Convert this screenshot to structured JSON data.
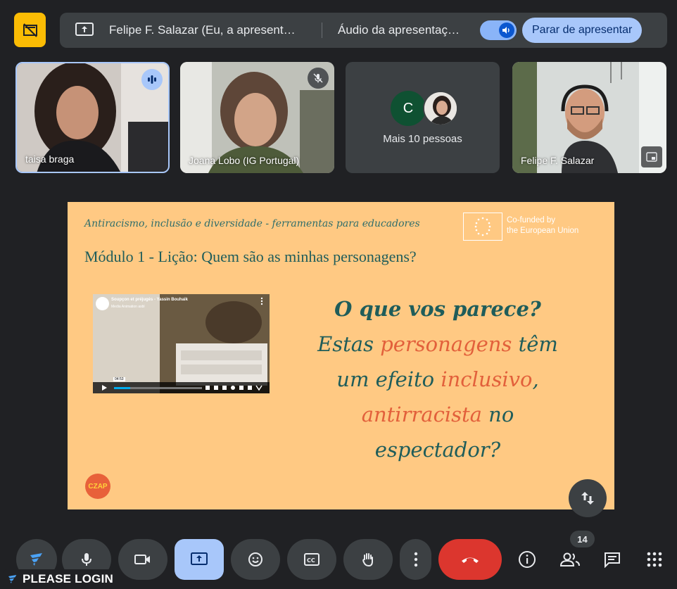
{
  "presenting": {
    "text": "Felipe F. Salazar (Eu, a apresent…",
    "audio_text": "Áudio da apresentaç…",
    "stop_label": "Parar de apresentar"
  },
  "participants": [
    {
      "name": "taisa braga",
      "speaking": true
    },
    {
      "name": "Joana Lobo (IG Portugal)",
      "muted": true
    },
    {
      "more_initial": "C",
      "more_label": "Mais 10 pessoas"
    },
    {
      "name": "Felipe F. Salazar"
    }
  ],
  "slide": {
    "header": "Antiracismo, inclusão e diversidade - ferramentas para educadores",
    "cofunded_line1": "Co-funded by",
    "cofunded_line2": "the European Union",
    "title": "Módulo 1 - Lição: Quem são as minhas personagens?",
    "video_title": "Soupçon et préjugés - Yassin Bouhaik",
    "video_channel": "Media Animation asbl",
    "video_time": "04:53",
    "video_progress": 0.18,
    "question_bold": "O que vos parece?",
    "line2_a": "Estas ",
    "line2_hl": "personagens",
    "line2_b": " têm",
    "line3_a": "um efeito ",
    "line3_hl": "inclusivo",
    "line3_b": ",",
    "line4_hl": "antirracista",
    "line4_b": " no",
    "line5": "espectador?",
    "logo_text": "CZAP"
  },
  "controls": {
    "people_count": "14",
    "login_label": "PLEASE LOGIN"
  },
  "colors": {
    "background": "#202124",
    "slide_bg": "#ffc983",
    "teal": "#1f5d5a",
    "orange": "#e2603b",
    "hangup": "#dc362e",
    "active": "#a8c7fa"
  }
}
